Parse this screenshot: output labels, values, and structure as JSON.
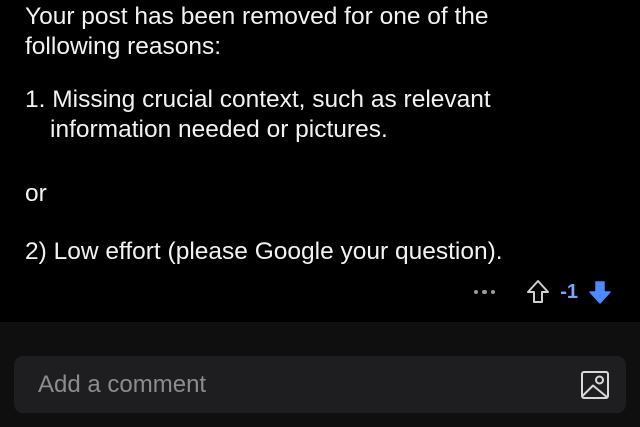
{
  "comment": {
    "intro_line1": "Your post has been removed for one of the",
    "intro_line2": "following reasons:",
    "reason1_line1": "1. Missing crucial context, such as relevant",
    "reason1_line2": "information needed or pictures.",
    "or_text": "or",
    "reason2": "2) Low effort (please Google your question)."
  },
  "actions": {
    "score": "-1",
    "more_icon": "more-horizontal-icon",
    "upvote_icon": "arrow-up-outline-icon",
    "downvote_icon": "arrow-down-filled-icon",
    "downvote_active": true,
    "score_color": "#7da4ff"
  },
  "composer": {
    "placeholder": "Add a comment",
    "image_icon": "image-attach-icon"
  },
  "colors": {
    "background": "#000000",
    "composer_bg": "#1e1e20",
    "accent_blue": "#7da4ff"
  }
}
